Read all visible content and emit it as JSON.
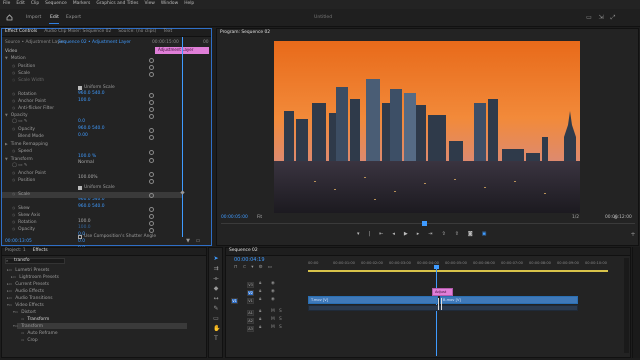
{
  "menu": [
    "File",
    "Edit",
    "Clip",
    "Sequence",
    "Markers",
    "Graphics and Titles",
    "View",
    "Window",
    "Help"
  ],
  "workspace": {
    "tabs": [
      "Import",
      "Edit",
      "Export"
    ],
    "active": "Edit",
    "project_title": "Untitled"
  },
  "effect_controls": {
    "tabs": [
      "Effect Controls",
      "Audio Clip Mixer: Sequence 02",
      "Source: (no clips)",
      "Text"
    ],
    "source_label": "Source • Adjustment Layer",
    "sequence_label": "Sequence 02 • Adjustment Layer",
    "timecode_left": "00:00:15:00",
    "timecode_right": "00",
    "clip_bar_label": "Adjustment Layer",
    "section_video": "Video",
    "rows": [
      {
        "label": "Motion",
        "value": ""
      },
      {
        "label": "Position",
        "value": "960.0   540.0"
      },
      {
        "label": "Scale",
        "value": "100.0"
      },
      {
        "label": "Scale Width",
        "value": ""
      },
      {
        "label": "",
        "value": "Uniform Scale"
      },
      {
        "label": "Rotation",
        "value": "0.0"
      },
      {
        "label": "Anchor Point",
        "value": "960.0   540.0"
      },
      {
        "label": "Anti-flicker Filter",
        "value": "0.00"
      },
      {
        "label": "Opacity",
        "value": ""
      },
      {
        "label": "Opacity",
        "value": "100.0 %"
      },
      {
        "label": "Blend Mode",
        "value": "Normal"
      },
      {
        "label": "Time Remapping",
        "value": ""
      },
      {
        "label": "Speed",
        "value": "100.00%"
      },
      {
        "label": "Transform",
        "value": ""
      },
      {
        "label": "Anchor Point",
        "value": "960.0   540.0"
      },
      {
        "label": "Position",
        "value": "960.0   540.0"
      },
      {
        "label": "",
        "value": "Uniform Scale"
      },
      {
        "label": "Scale",
        "value": "100.0"
      },
      {
        "label": "",
        "value": "100.0"
      },
      {
        "label": "Skew",
        "value": "0.0"
      },
      {
        "label": "Skew Axis",
        "value": "0.0"
      },
      {
        "label": "Rotation",
        "value": "0.0"
      },
      {
        "label": "Opacity",
        "value": "100.0"
      },
      {
        "label": "",
        "value": "Use Composition's Shutter Angle"
      }
    ],
    "footer_time": "00:00:13:05"
  },
  "program": {
    "title": "Program: Sequence 02",
    "timecode": "00:00:05:00",
    "fit": "Fit",
    "quality": "1/2",
    "duration": "00:00:12:00"
  },
  "effects_panel": {
    "tabs": [
      "Project: 1",
      "Effects"
    ],
    "search": "transfo",
    "items": [
      "Lumetri Presets",
      "Lightroom Presets",
      "Current Presets",
      "Audio Effects",
      "Audio Transitions",
      "Video Effects",
      "Distort",
      "Transform",
      "Transform",
      "Auto Reframe",
      "Crop"
    ]
  },
  "timeline": {
    "tab": "Sequence 02",
    "timecode": "00:00:04:19",
    "ruler": [
      "00:00",
      "00:00:01:00",
      "00:00:02:00",
      "00:00:03:00",
      "00:00:04:00",
      "00:00:05:00",
      "00:00:06:00",
      "00:00:07:00",
      "00:00:08:00",
      "00:00:09:00",
      "00:00:10:00"
    ],
    "tracks": [
      "V3",
      "V2",
      "V1",
      "A1",
      "A2",
      "A3"
    ],
    "clips": [
      {
        "track": "V2",
        "label": "Adjust"
      },
      {
        "track": "V1",
        "label": "T.mov [V]"
      },
      {
        "track": "V1",
        "label": "B.mov [V]"
      }
    ]
  },
  "colors": {
    "accent": "#2f7fe0",
    "clip_blue": "#3f79b9",
    "adj_pink": "#e07fd8",
    "playhead": "#3f9bff"
  }
}
